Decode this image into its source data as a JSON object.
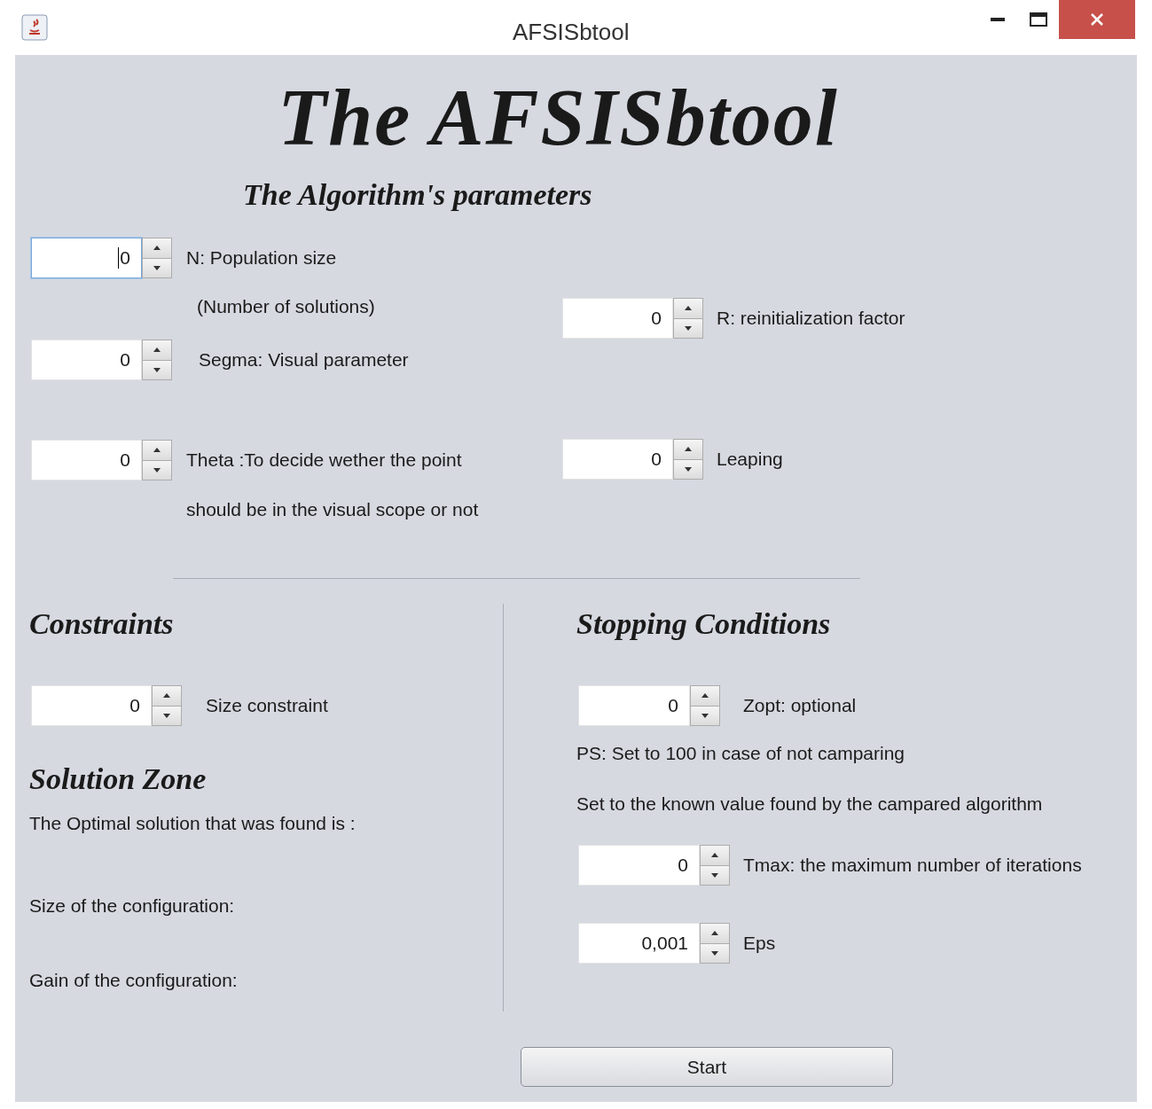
{
  "window": {
    "title": "AFSISbtool"
  },
  "heading": "The AFSISbtool",
  "parameters": {
    "title": "The Algorithm's parameters",
    "left": [
      {
        "value": "0",
        "focused": true,
        "label": "N: Population size",
        "note": "(Number of solutions)"
      },
      {
        "value": "0",
        "focused": false,
        "label": "Segma: Visual parameter"
      },
      {
        "value": "0",
        "focused": false,
        "label": "Theta :To decide wether the point",
        "note": "should be in the visual scope or not"
      }
    ],
    "right": [
      {
        "value": "0",
        "focused": false,
        "label": "R: reinitialization factor"
      },
      {
        "value": "0",
        "focused": false,
        "label": "Leaping"
      }
    ]
  },
  "constraints": {
    "title": "Constraints",
    "spinner": {
      "value": "0",
      "focused": false,
      "label": "Size constraint"
    }
  },
  "solution_zone": {
    "title": "Solution Zone",
    "lines": [
      "The Optimal solution that was found is :",
      "Size of the configuration:",
      "Gain of the configuration:"
    ]
  },
  "stopping_conditions": {
    "title": "Stopping Conditions",
    "zopt": {
      "value": "0",
      "focused": false,
      "label": "Zopt: optional"
    },
    "notes": [
      "PS: Set to 100 in case of not camparing",
      "Set to the known value found by the campared algorithm"
    ],
    "spinners": [
      {
        "value": "0",
        "focused": false,
        "label": "Tmax: the maximum number of iterations"
      },
      {
        "value": "0,001",
        "focused": false,
        "label": "Eps"
      }
    ]
  },
  "start_button": "Start"
}
